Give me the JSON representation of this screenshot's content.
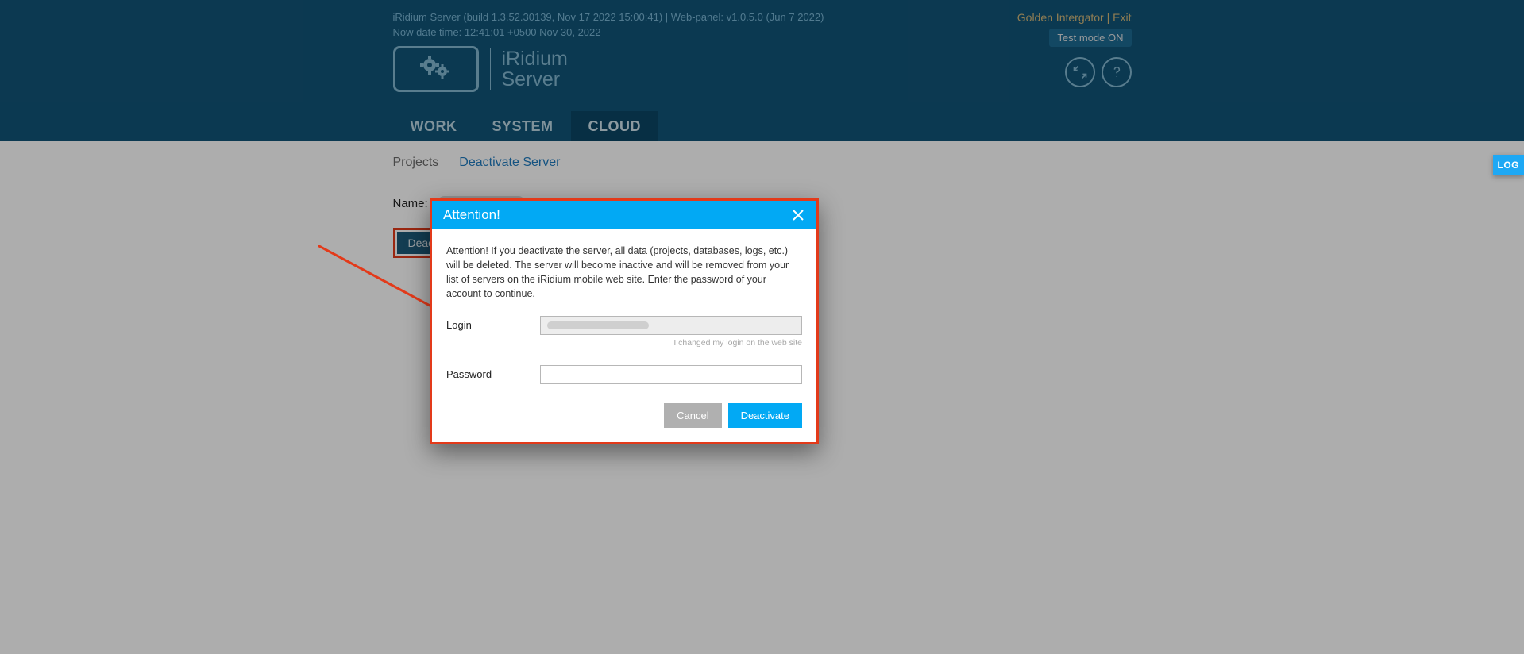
{
  "header": {
    "build_line": "iRidium Server (build 1.3.52.30139, Nov 17 2022 15:00:41) | Web-panel: v1.0.5.0 (Jun 7 2022)",
    "date_line": "Now date time: 12:41:01 +0500 Nov 30, 2022",
    "user_name": "Golden Intergator",
    "exit_label": "Exit",
    "test_mode_label": "Test mode ON",
    "brand_line1": "iRidium",
    "brand_line2": "Server",
    "tabs": {
      "work": "WORK",
      "system": "SYSTEM",
      "cloud": "CLOUD"
    }
  },
  "subTabs": {
    "projects": "Projects",
    "deactivate": "Deactivate Server"
  },
  "page": {
    "name_label": "Name:",
    "deactivate_button": "Deactivate"
  },
  "modal": {
    "title": "Attention!",
    "body_text": "Attention! If you deactivate the server, all data (projects, databases, logs, etc.) will be deleted. The server will become inactive and will be removed from your list of servers on the iRidium mobile web site. Enter the password of your account to continue.",
    "login_label": "Login",
    "password_label": "Password",
    "changed_login_hint": "I changed my login on the web site",
    "cancel_label": "Cancel",
    "deactivate_label": "Deactivate"
  },
  "side": {
    "log_label": "LOG"
  }
}
